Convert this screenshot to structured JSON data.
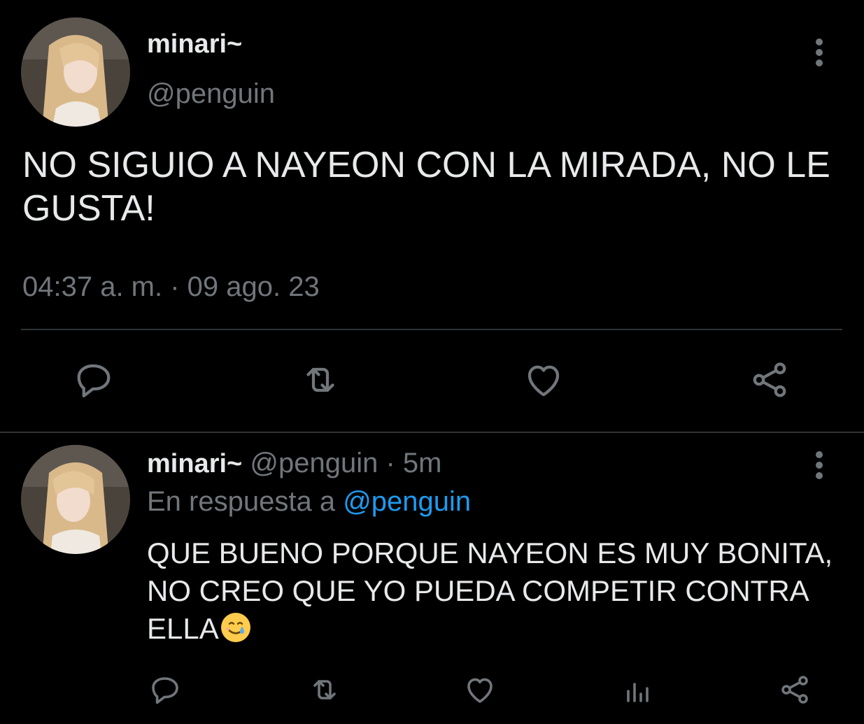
{
  "main_tweet": {
    "author_name": "minari~",
    "author_handle": "@penguin",
    "text": "NO SIGUIO A NAYEON CON LA MIRADA, NO LE GUSTA!",
    "timestamp": "04:37 a. m. · 09 ago. 23",
    "actions": [
      "reply-icon",
      "retweet-icon",
      "like-icon",
      "share-icon"
    ]
  },
  "reply_tweet": {
    "author_name": "minari~",
    "author_handle": "@penguin",
    "time_ago": "· 5m",
    "reply_prefix": "En respuesta a",
    "reply_mention": "@penguin",
    "text": "QUE BUENO PORQUE NAYEON ES MUY BONITA, NO CREO QUE YO PUEDA COMPETIR CONTRA ELLA",
    "emoji": "smiling-face-with-tear",
    "actions": [
      "reply-icon",
      "retweet-icon",
      "like-icon",
      "views-icon",
      "share-icon"
    ]
  },
  "colors": {
    "background": "#000000",
    "text_primary": "#e7e9ea",
    "text_secondary": "#71767b",
    "link": "#1d9bf0",
    "divider": "#2f3336"
  }
}
